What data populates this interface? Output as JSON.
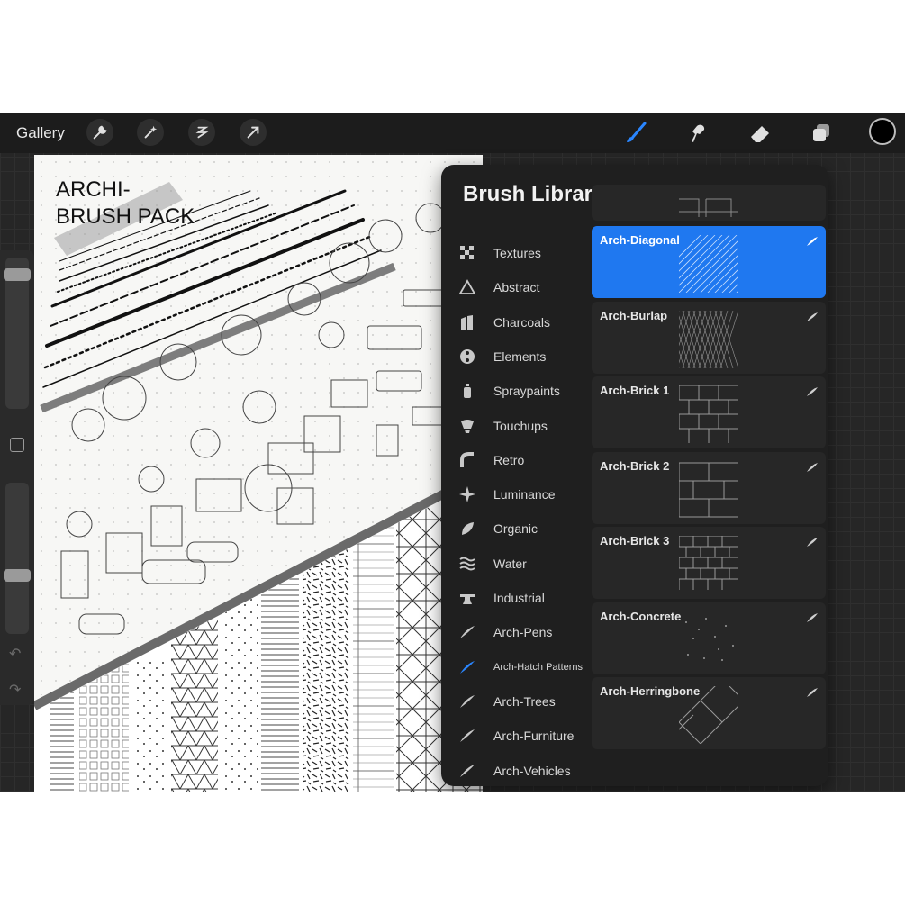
{
  "topbar": {
    "gallery_label": "Gallery",
    "left_tools": [
      "wrench-icon",
      "magic-wand-icon",
      "selection-icon",
      "transform-arrow-icon"
    ],
    "right_tools": [
      "brush-icon",
      "smudge-icon",
      "eraser-icon",
      "layers-icon"
    ],
    "current_color": "#000000"
  },
  "canvas": {
    "title_line1": "ARCHI-",
    "title_line2": "BRUSH PACK"
  },
  "library": {
    "title": "Brush Library",
    "add_symbol": "+",
    "accent": "#1f78f0",
    "sets": [
      {
        "label": "Textures",
        "icon": "textures-icon"
      },
      {
        "label": "Abstract",
        "icon": "abstract-icon"
      },
      {
        "label": "Charcoals",
        "icon": "charcoals-icon"
      },
      {
        "label": "Elements",
        "icon": "elements-icon"
      },
      {
        "label": "Spraypaints",
        "icon": "spraypaints-icon"
      },
      {
        "label": "Touchups",
        "icon": "touchups-icon"
      },
      {
        "label": "Retro",
        "icon": "retro-icon"
      },
      {
        "label": "Luminance",
        "icon": "luminance-icon"
      },
      {
        "label": "Organic",
        "icon": "organic-icon"
      },
      {
        "label": "Water",
        "icon": "water-icon"
      },
      {
        "label": "Industrial",
        "icon": "industrial-icon"
      },
      {
        "label": "Arch-Pens",
        "icon": "custom-brush-set-icon"
      },
      {
        "label": "Arch-Hatch Patterns",
        "icon": "custom-brush-set-icon",
        "selected": true
      },
      {
        "label": "Arch-Trees",
        "icon": "custom-brush-set-icon"
      },
      {
        "label": "Arch-Furniture",
        "icon": "custom-brush-set-icon"
      },
      {
        "label": "Arch-Vehicles",
        "icon": "custom-brush-set-icon"
      }
    ],
    "brushes": [
      {
        "name": "Arch-Diagonal",
        "selected": true
      },
      {
        "name": "Arch-Burlap"
      },
      {
        "name": "Arch-Brick 1"
      },
      {
        "name": "Arch-Brick 2"
      },
      {
        "name": "Arch-Brick 3"
      },
      {
        "name": "Arch-Concrete"
      },
      {
        "name": "Arch-Herringbone"
      }
    ]
  }
}
